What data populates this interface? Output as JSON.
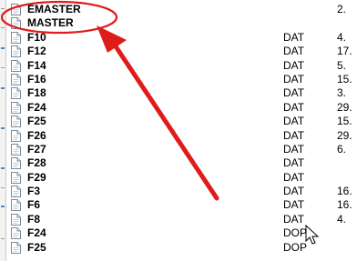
{
  "files": [
    {
      "name": "EMASTER",
      "type": "",
      "size": "2."
    },
    {
      "name": "MASTER",
      "type": "",
      "size": ""
    },
    {
      "name": "F10",
      "type": "DAT",
      "size": "4."
    },
    {
      "name": "F12",
      "type": "DAT",
      "size": "17."
    },
    {
      "name": "F14",
      "type": "DAT",
      "size": "5."
    },
    {
      "name": "F16",
      "type": "DAT",
      "size": "15."
    },
    {
      "name": "F18",
      "type": "DAT",
      "size": "3."
    },
    {
      "name": "F24",
      "type": "DAT",
      "size": "29."
    },
    {
      "name": "F25",
      "type": "DAT",
      "size": "15."
    },
    {
      "name": "F26",
      "type": "DAT",
      "size": "29."
    },
    {
      "name": "F27",
      "type": "DAT",
      "size": "6."
    },
    {
      "name": "F28",
      "type": "DAT",
      "size": ""
    },
    {
      "name": "F29",
      "type": "DAT",
      "size": ""
    },
    {
      "name": "F3",
      "type": "DAT",
      "size": "16."
    },
    {
      "name": "F6",
      "type": "DAT",
      "size": "16."
    },
    {
      "name": "F8",
      "type": "DAT",
      "size": "4."
    },
    {
      "name": "F24",
      "type": "DOP",
      "size": ""
    },
    {
      "name": "F25",
      "type": "DOP",
      "size": ""
    }
  ],
  "annotation": {
    "ellipse_color": "#e01b1b",
    "arrow_color": "#e01b1b",
    "highlighted_file": "MASTER"
  },
  "icons": {
    "file": "document-icon",
    "cursor": "mouse-pointer-icon"
  }
}
